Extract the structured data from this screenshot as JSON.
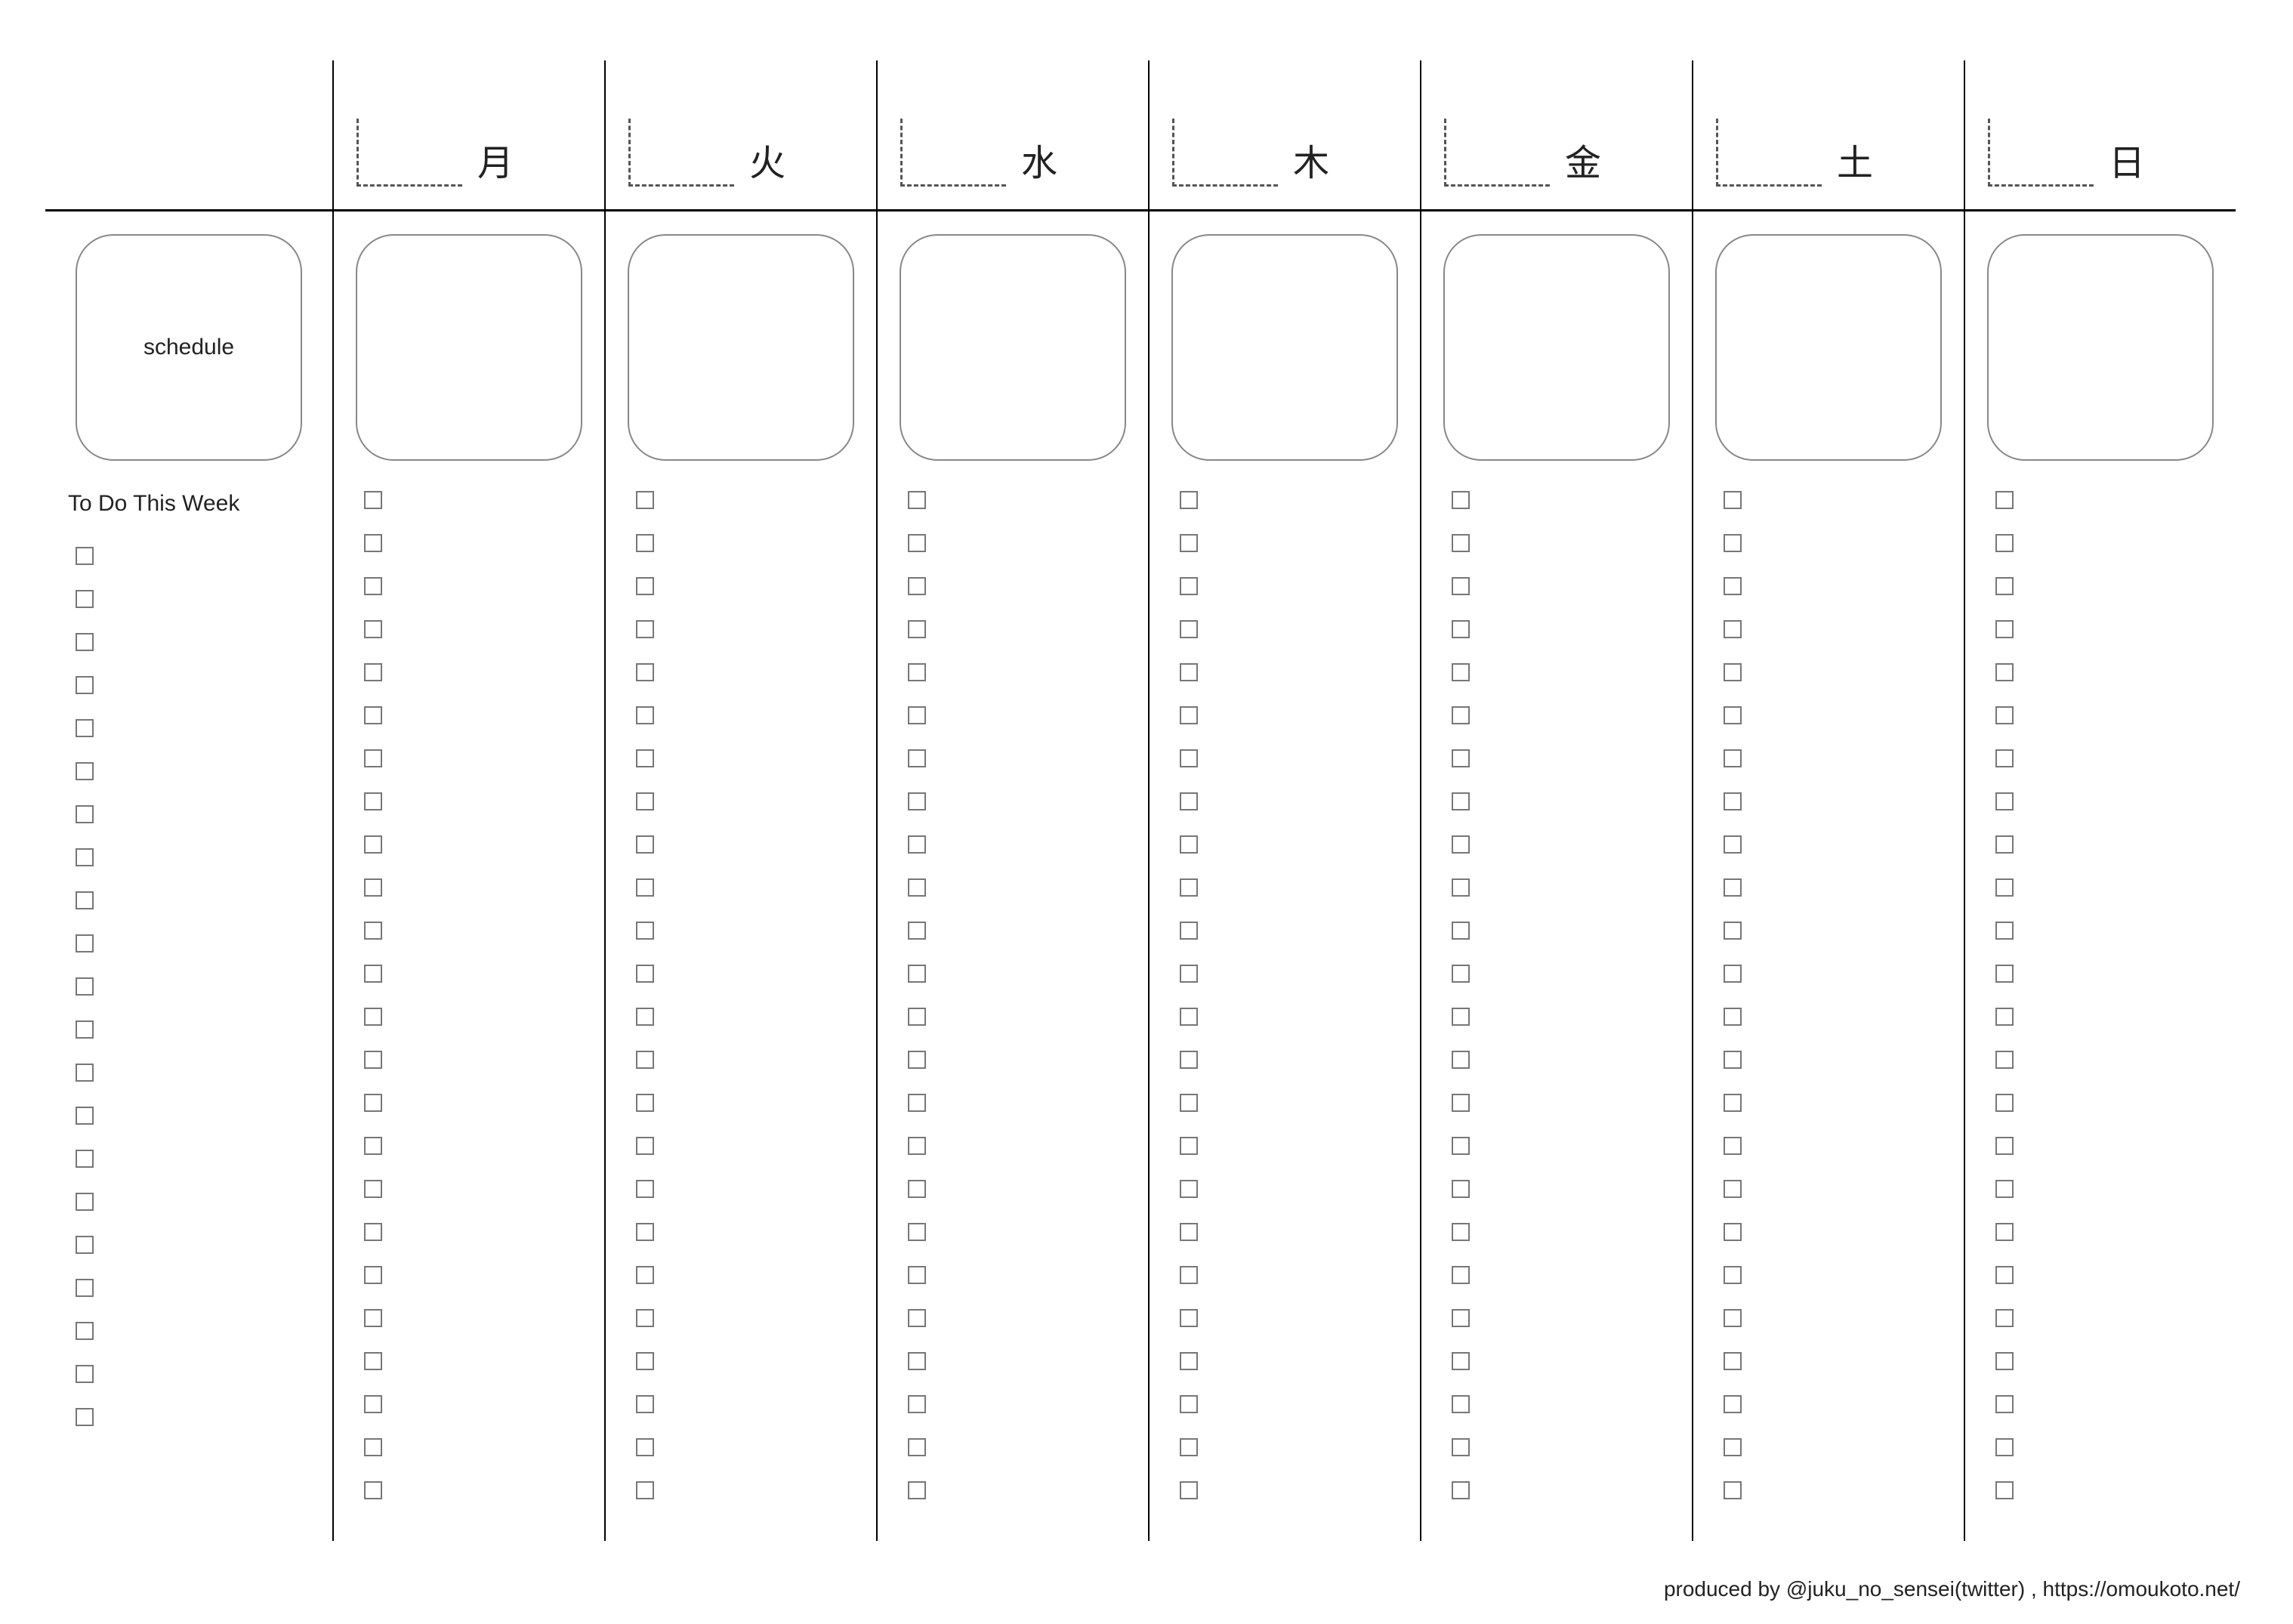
{
  "days": [
    {
      "label": "月"
    },
    {
      "label": "火"
    },
    {
      "label": "水"
    },
    {
      "label": "木"
    },
    {
      "label": "金"
    },
    {
      "label": "土"
    },
    {
      "label": "日"
    }
  ],
  "left": {
    "schedule_label": "schedule",
    "todo_title": "To Do This Week",
    "todo_count": 21
  },
  "day_checkbox_count": 24,
  "footer": "produced by @juku_no_sensei(twitter) , https://omoukoto.net/"
}
